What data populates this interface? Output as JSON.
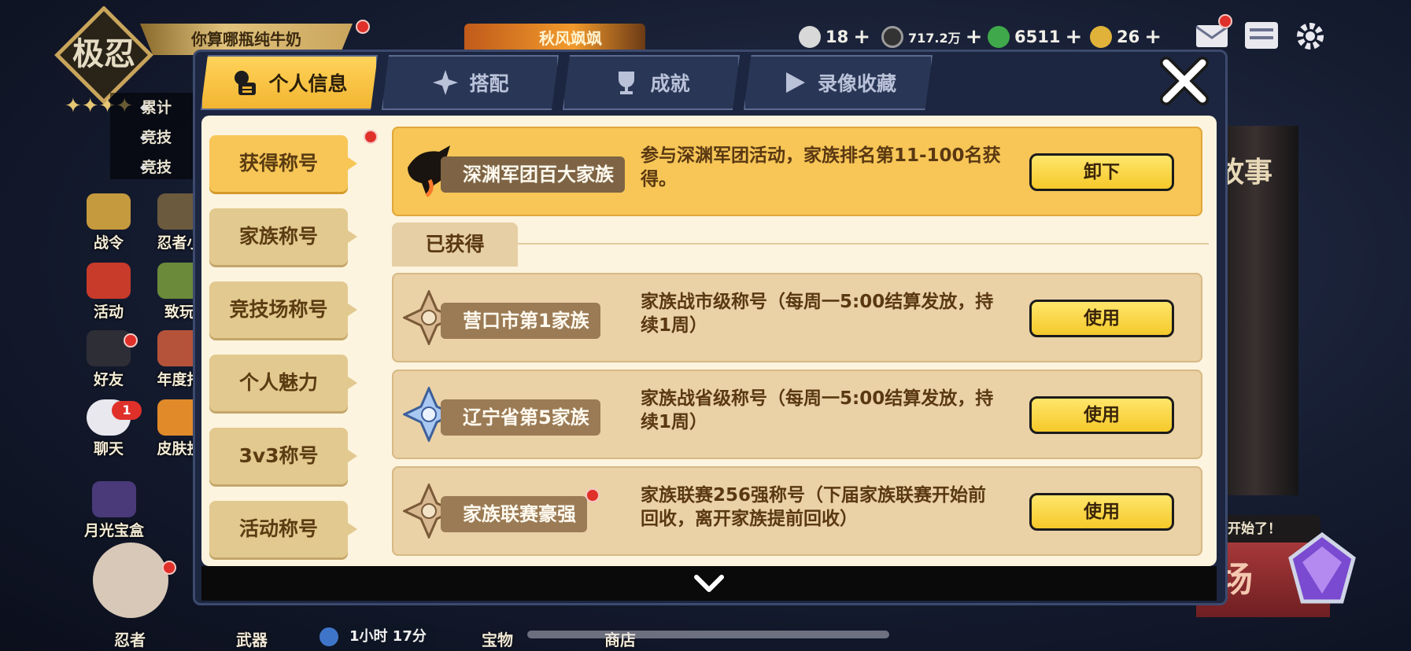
{
  "hud": {
    "rank_badge_text": "极忍",
    "player_name": "你算哪瓶纯牛奶",
    "season_label": "秋风飒飒",
    "resources": [
      {
        "icon": "onigiri-icon",
        "value": "18",
        "color": "#d8d8d8"
      },
      {
        "icon": "coin-icon",
        "value": "717.2万",
        "color": "#9a9a9a"
      },
      {
        "icon": "jade-icon",
        "value": "6511",
        "color": "#3fa84a"
      },
      {
        "icon": "gold-ticket-icon",
        "value": "26",
        "color": "#e0b23a"
      }
    ],
    "plus_symbol": "+",
    "background_list": [
      "累计",
      "竞技",
      "竞技"
    ],
    "left_menu": [
      "战令",
      "忍者小",
      "活动",
      "致玩",
      "好友",
      "年度报",
      "聊天",
      "皮肤投",
      "月光宝盒"
    ],
    "chat_badge_count": "1",
    "right_scroll_text": "故事",
    "notice_text": "开始了！",
    "red_banner_text": "场",
    "bottom_menu": [
      "忍者",
      "武器",
      "宝物",
      "商店"
    ],
    "timer_text": "1小时 17分"
  },
  "dialog": {
    "tabs": [
      {
        "label": "个人信息",
        "icon": "profile-icon",
        "active": true
      },
      {
        "label": "搭配",
        "icon": "star-compass-icon",
        "active": false
      },
      {
        "label": "成就",
        "icon": "trophy-icon",
        "active": false
      },
      {
        "label": "录像收藏",
        "icon": "play-icon",
        "active": false
      }
    ],
    "categories": [
      {
        "label": "获得称号",
        "active": true,
        "has_dot": true
      },
      {
        "label": "家族称号",
        "active": false,
        "has_dot": false
      },
      {
        "label": "竞技场称号",
        "active": false,
        "has_dot": false
      },
      {
        "label": "个人魅力",
        "active": false,
        "has_dot": false
      },
      {
        "label": "3v3称号",
        "active": false,
        "has_dot": false
      },
      {
        "label": "活动称号",
        "active": false,
        "has_dot": false
      }
    ],
    "equipped": {
      "name": "深渊军团百大家族",
      "description": "参与深渊军团活动，家族排名第11-100名获得。",
      "button": "卸下"
    },
    "obtained_label": "已获得",
    "obtained": [
      {
        "name": "营口市第1家族",
        "description": "家族战市级称号（每周一5:00结算发放，持续1周）",
        "button": "使用",
        "emblem": "bronze-compass-emblem-icon",
        "has_dot": false
      },
      {
        "name": "辽宁省第5家族",
        "description": "家族战省级称号（每周一5:00结算发放，持续1周）",
        "button": "使用",
        "emblem": "crystal-compass-emblem-icon",
        "has_dot": false
      },
      {
        "name": "家族联赛豪强",
        "description": "家族联赛256强称号（下届家族联赛开始前回收，离开家族提前回收）",
        "button": "使用",
        "emblem": "bronze-compass-emblem-icon",
        "has_dot": true
      }
    ]
  }
}
